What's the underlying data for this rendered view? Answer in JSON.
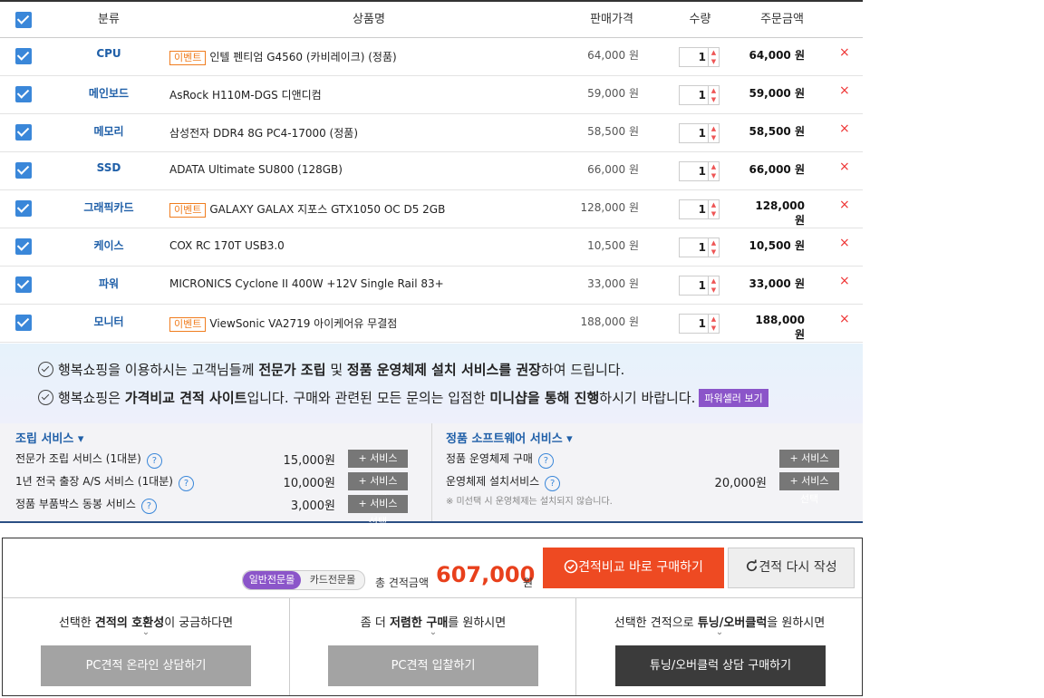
{
  "header": {
    "category": "분류",
    "product": "상품명",
    "price": "판매가격",
    "qty": "수량",
    "total": "주문금액"
  },
  "rows": [
    {
      "category": "CPU",
      "event": "이벤트",
      "name": "인텔 펜티엄 G4560 (카비레이크) (정품)",
      "price": "64,000 원",
      "qty": "1",
      "total": "64,000 원"
    },
    {
      "category": "메인보드",
      "event": "",
      "name": "AsRock H110M-DGS 디앤디컴",
      "price": "59,000 원",
      "qty": "1",
      "total": "59,000 원"
    },
    {
      "category": "메모리",
      "event": "",
      "name": "삼성전자 DDR4 8G PC4-17000 (정품)",
      "price": "58,500 원",
      "qty": "1",
      "total": "58,500 원"
    },
    {
      "category": "SSD",
      "event": "",
      "name": "ADATA Ultimate SU800 (128GB)",
      "price": "66,000 원",
      "qty": "1",
      "total": "66,000 원"
    },
    {
      "category": "그래픽카드",
      "event": "이벤트",
      "name": "GALAXY GALAX 지포스 GTX1050 OC D5 2GB",
      "price": "128,000 원",
      "qty": "1",
      "total": "128,000 원"
    },
    {
      "category": "케이스",
      "event": "",
      "name": "COX RC 170T USB3.0",
      "price": "10,500 원",
      "qty": "1",
      "total": "10,500 원"
    },
    {
      "category": "파워",
      "event": "",
      "name": "MICRONICS Cyclone II 400W +12V Single Rail 83+",
      "price": "33,000 원",
      "qty": "1",
      "total": "33,000 원"
    },
    {
      "category": "모니터",
      "event": "이벤트",
      "name": "ViewSonic VA2719 아이케어유 무결점",
      "price": "188,000 원",
      "qty": "1",
      "total": "188,000 원"
    }
  ],
  "delete_icon": "×",
  "notice": {
    "line1_a": "행복쇼핑을 이용하시는 고객님들께 ",
    "line1_b": "전문가 조립",
    "line1_c": " 및 ",
    "line1_d": "정품 운영체제 설치 서비스를 권장",
    "line1_e": "하여 드립니다.",
    "line2_a": "행복쇼핑은 ",
    "line2_b": "가격비교 견적 사이트",
    "line2_c": "입니다. 구매와 관련된 모든 문의는 입점한 ",
    "line2_d": "미니샵을 통해 진행",
    "line2_e": "하시기 바랍니다.",
    "seller_button": "파워셀러 보기"
  },
  "services": {
    "assembly_title": "조립 서비스 ▾",
    "software_title": "정품 소프트웨어 서비스 ▾",
    "assembly": [
      {
        "label": "전문가 조립 서비스 (1대분)",
        "price": "15,000원",
        "button": "+ 서비스 선택"
      },
      {
        "label": "1년 전국 출장 A/S 서비스 (1대분)",
        "price": "10,000원",
        "button": "+ 서비스 선택"
      },
      {
        "label": "정품 부품박스 동봉 서비스",
        "price": "3,000원",
        "button": "+ 서비스 선택"
      }
    ],
    "software": [
      {
        "label": "정품 운영체제 구매",
        "price": "",
        "button": "+ 서비스 선택"
      },
      {
        "label": "운영체제 설치서비스",
        "price": "20,000원",
        "button": "+ 서비스 선택"
      }
    ],
    "note": "※ 미선택 시 운영체제는 설치되지 않습니다.",
    "help_icon": "?"
  },
  "summary": {
    "tab_general": "일반전문몰",
    "tab_card": "카드전문몰",
    "total_label": "총 견적금액",
    "total_value": "607,000",
    "total_unit": "원",
    "buy_button": "견적비교 바로 구매하기",
    "redo_button": "견적 다시 작성"
  },
  "bottom": [
    {
      "text_a": "선택한 ",
      "text_b": "견적의 호환성",
      "text_c": "이 궁금하다면",
      "button": "PC견적 온라인 상담하기"
    },
    {
      "text_a": "좀 더 ",
      "text_b": "저렴한 구매",
      "text_c": "를 원하시면",
      "button": "PC견적 입찰하기"
    },
    {
      "text_a": "선택한 견적으로 ",
      "text_b": "튜닝/오버클럭",
      "text_c": "을 원하시면",
      "button": "튜닝/오버클럭 상담 구매하기"
    }
  ]
}
